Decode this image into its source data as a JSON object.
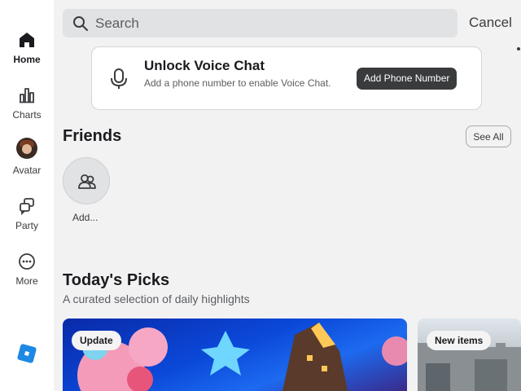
{
  "sidebar": {
    "items": [
      {
        "label": "Home",
        "icon": "home-icon",
        "active": true
      },
      {
        "label": "Charts",
        "icon": "charts-icon",
        "active": false
      },
      {
        "label": "Avatar",
        "icon": "avatar-icon",
        "active": false
      },
      {
        "label": "Party",
        "icon": "party-icon",
        "active": false
      },
      {
        "label": "More",
        "icon": "more-icon",
        "active": false
      }
    ],
    "logo": "roblox-logo-icon"
  },
  "search": {
    "placeholder": "Search",
    "cancel_label": "Cancel"
  },
  "voice_chat": {
    "title": "Unlock Voice Chat",
    "subtitle": "Add a phone number to enable Voice Chat.",
    "button_label": "Add Phone Number",
    "icon": "microphone-icon"
  },
  "friends": {
    "title": "Friends",
    "see_all_label": "See All",
    "add_label": "Add...",
    "icon": "add-friends-icon"
  },
  "todays_picks": {
    "title": "Today's Picks",
    "subtitle": "A curated selection of daily highlights",
    "tiles": [
      {
        "tag": "Update",
        "accent": "#0b48d8"
      },
      {
        "tag": "New items",
        "accent": "#c5ccd2"
      }
    ]
  },
  "colors": {
    "background": "#f2f2f3",
    "button_dark": "#393b3d",
    "logo_blue": "#1e88e5"
  }
}
